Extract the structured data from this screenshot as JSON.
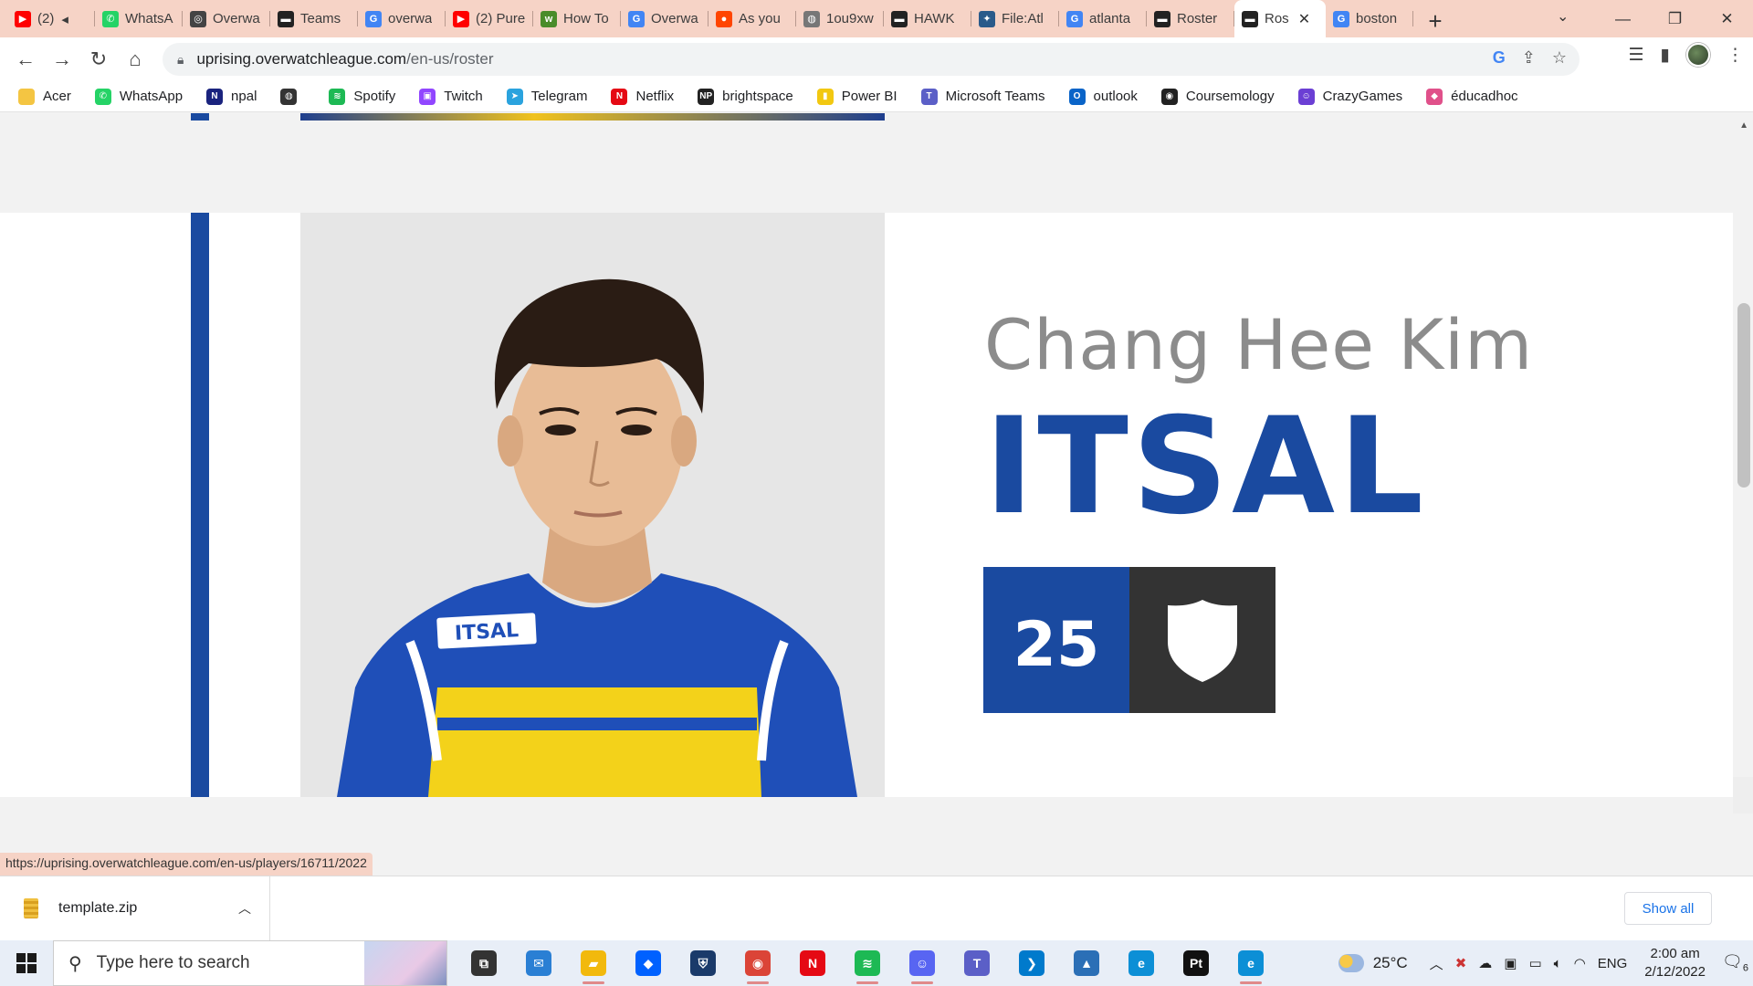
{
  "browser": {
    "tabs": [
      {
        "title": "(2)",
        "icon": "youtube-icon",
        "color": "#ff0000",
        "glyph": "▶",
        "width": 96,
        "muted": true
      },
      {
        "title": "WhatsA",
        "icon": "whatsapp-icon",
        "color": "#25d366",
        "glyph": "✆",
        "width": 96
      },
      {
        "title": "Overwa",
        "icon": "overwatch-icon",
        "color": "#444444",
        "glyph": "◎",
        "width": 96
      },
      {
        "title": "Teams",
        "icon": "overwatch-league-icon",
        "color": "#222222",
        "glyph": "▬",
        "width": 96
      },
      {
        "title": "overwa",
        "icon": "google-icon",
        "color": "#4285f4",
        "glyph": "G",
        "width": 96
      },
      {
        "title": "(2) Pure",
        "icon": "youtube-icon",
        "color": "#ff0000",
        "glyph": "▶",
        "width": 96
      },
      {
        "title": "How To",
        "icon": "wikihow-icon",
        "color": "#4a8c2a",
        "glyph": "w",
        "width": 96
      },
      {
        "title": "Overwa",
        "icon": "google-icon",
        "color": "#4285f4",
        "glyph": "G",
        "width": 96
      },
      {
        "title": "As you",
        "icon": "reddit-icon",
        "color": "#ff4500",
        "glyph": "●",
        "width": 96
      },
      {
        "title": "1ou9xw",
        "icon": "globe-icon",
        "color": "#777777",
        "glyph": "◍",
        "width": 96
      },
      {
        "title": "HAWK",
        "icon": "overwatch-league-icon",
        "color": "#222222",
        "glyph": "▬",
        "width": 96
      },
      {
        "title": "File:Atl",
        "icon": "wiki-file-icon",
        "color": "#2a5a8a",
        "glyph": "✦",
        "width": 96
      },
      {
        "title": "atlanta",
        "icon": "google-icon",
        "color": "#4285f4",
        "glyph": "G",
        "width": 96
      },
      {
        "title": "Roster",
        "icon": "overwatch-league-icon",
        "color": "#222222",
        "glyph": "▬",
        "width": 96
      },
      {
        "title": "Ros",
        "icon": "overwatch-league-icon",
        "color": "#222222",
        "glyph": "▬",
        "width": 100,
        "active": true
      },
      {
        "title": "boston",
        "icon": "google-icon",
        "color": "#4285f4",
        "glyph": "G",
        "width": 96
      }
    ],
    "url_host": "uprising.overwatchleague.com",
    "url_path": "/en-us/roster",
    "bookmarks": [
      {
        "label": "Acer",
        "icon": "folder-icon",
        "color": "#f4c542",
        "glyph": ""
      },
      {
        "label": "WhatsApp",
        "icon": "whatsapp-icon",
        "color": "#25d366",
        "glyph": "✆"
      },
      {
        "label": "npal",
        "icon": "npal-icon",
        "color": "#1a237e",
        "glyph": "N"
      },
      {
        "label": "",
        "icon": "globe-icon",
        "color": "#333333",
        "glyph": "◍"
      },
      {
        "label": "Spotify",
        "icon": "spotify-icon",
        "color": "#1db954",
        "glyph": "≋"
      },
      {
        "label": "Twitch",
        "icon": "twitch-icon",
        "color": "#9146ff",
        "glyph": "▣"
      },
      {
        "label": "Telegram",
        "icon": "telegram-icon",
        "color": "#2aa3de",
        "glyph": "➤"
      },
      {
        "label": "Netflix",
        "icon": "netflix-icon",
        "color": "#e50914",
        "glyph": "N"
      },
      {
        "label": "brightspace",
        "icon": "brightspace-icon",
        "color": "#222222",
        "glyph": "NP"
      },
      {
        "label": "Power BI",
        "icon": "power-bi-icon",
        "color": "#f2c811",
        "glyph": "▮"
      },
      {
        "label": "Microsoft Teams",
        "icon": "teams-icon",
        "color": "#5b5fc7",
        "glyph": "T"
      },
      {
        "label": "outlook",
        "icon": "outlook-icon",
        "color": "#0a64c8",
        "glyph": "O"
      },
      {
        "label": "Coursemology",
        "icon": "coursemology-icon",
        "color": "#222222",
        "glyph": "◉"
      },
      {
        "label": "CrazyGames",
        "icon": "crazygames-icon",
        "color": "#6b3fd4",
        "glyph": "☺"
      },
      {
        "label": "éducadhoc",
        "icon": "educadhoc-icon",
        "color": "#e0508a",
        "glyph": "◆"
      }
    ]
  },
  "player": {
    "real_name": "Chang Hee Kim",
    "gamertag": "ITSAL",
    "number": "25",
    "role_icon": "shield-icon",
    "jersey_name": "ITSAL"
  },
  "status_bar": {
    "url": "https://uprising.overwatchleague.com/en-us/players/16711/2022"
  },
  "downloads": {
    "file": "template.zip",
    "show_all": "Show all"
  },
  "taskbar": {
    "search_placeholder": "Type here to search",
    "apps": [
      {
        "icon": "task-view-icon",
        "color": "#333333",
        "glyph": "⧉",
        "running": false
      },
      {
        "icon": "mail-icon",
        "color": "#2a7fd4",
        "glyph": "✉",
        "running": false
      },
      {
        "icon": "file-explorer-icon",
        "color": "#f2b90d",
        "glyph": "▰",
        "running": true
      },
      {
        "icon": "dropbox-icon",
        "color": "#0061ff",
        "glyph": "◆",
        "running": false
      },
      {
        "icon": "overwatch-app-icon",
        "color": "#1a3a6a",
        "glyph": "⛨",
        "running": false
      },
      {
        "icon": "chrome-icon",
        "color": "#db4437",
        "glyph": "◉",
        "running": true
      },
      {
        "icon": "netflix-icon",
        "color": "#e50914",
        "glyph": "N",
        "running": false
      },
      {
        "icon": "spotify-icon",
        "color": "#1db954",
        "glyph": "≋",
        "running": true
      },
      {
        "icon": "discord-icon",
        "color": "#5865f2",
        "glyph": "☺",
        "running": true
      },
      {
        "icon": "teams-icon",
        "color": "#5b5fc7",
        "glyph": "T",
        "running": false
      },
      {
        "icon": "vscode-icon",
        "color": "#007acc",
        "glyph": "❯",
        "running": false
      },
      {
        "icon": "photos-icon",
        "color": "#2b6fb6",
        "glyph": "▲",
        "running": false
      },
      {
        "icon": "edge-icon",
        "color": "#0c8fd6",
        "glyph": "e",
        "running": false
      },
      {
        "icon": "pycharm-icon",
        "color": "#111111",
        "glyph": "Pt",
        "running": false
      },
      {
        "icon": "edge-dev-icon",
        "color": "#0c8fd6",
        "glyph": "e",
        "running": true
      }
    ],
    "weather": "25°C",
    "language": "ENG",
    "time": "2:00 am",
    "date": "2/12/2022",
    "notifications": "6"
  }
}
